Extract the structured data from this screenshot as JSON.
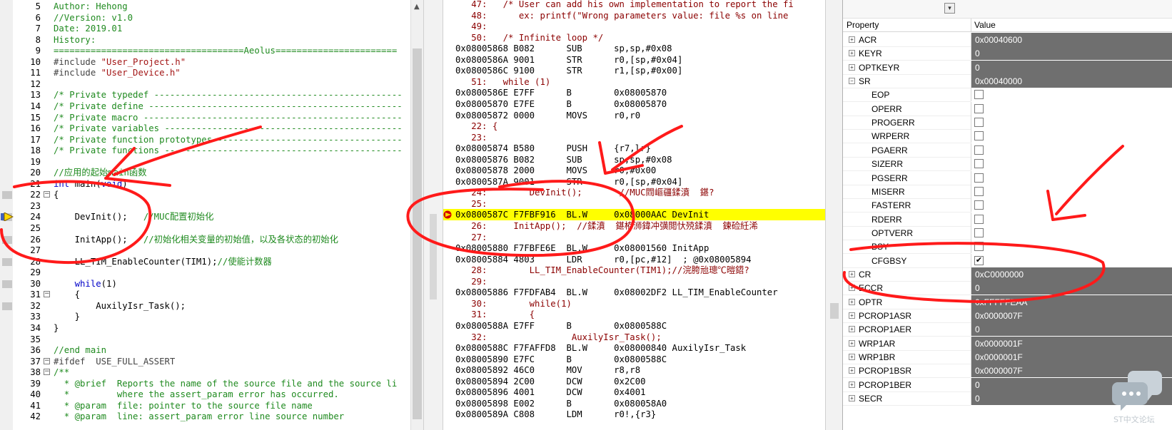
{
  "editor": {
    "lines": [
      {
        "n": "5",
        "text": "Author: Hehong",
        "cls": "c-comment",
        "fold": "",
        "mark": false
      },
      {
        "n": "6",
        "text": "//Version: v1.0",
        "cls": "c-comment",
        "fold": "",
        "mark": false
      },
      {
        "n": "7",
        "text": "Date: 2019.01",
        "cls": "c-comment",
        "fold": "",
        "mark": false
      },
      {
        "n": "8",
        "text": "History:",
        "cls": "c-comment",
        "fold": "",
        "mark": false
      },
      {
        "n": "9",
        "text": "====================================Aeolus=======================",
        "cls": "c-comment",
        "fold": "",
        "mark": false
      },
      {
        "n": "10",
        "text": "#include \"User_Project.h\"",
        "cls": "c-inc",
        "fold": "",
        "mark": false
      },
      {
        "n": "11",
        "text": "#include \"User_Device.h\"",
        "cls": "c-inc",
        "fold": "",
        "mark": false
      },
      {
        "n": "12",
        "text": "",
        "cls": "c-code",
        "fold": "",
        "mark": false
      },
      {
        "n": "13",
        "text": "/* Private typedef -----------------------------------------------",
        "cls": "c-comment",
        "fold": "",
        "mark": false
      },
      {
        "n": "14",
        "text": "/* Private define ------------------------------------------------",
        "cls": "c-comment",
        "fold": "",
        "mark": false
      },
      {
        "n": "15",
        "text": "/* Private macro -------------------------------------------------",
        "cls": "c-comment",
        "fold": "",
        "mark": false
      },
      {
        "n": "16",
        "text": "/* Private variables ---------------------------------------------",
        "cls": "c-comment",
        "fold": "",
        "mark": false
      },
      {
        "n": "17",
        "text": "/* Private function prototypes -----------------------------------",
        "cls": "c-comment",
        "fold": "",
        "mark": false
      },
      {
        "n": "18",
        "text": "/* Private functions ---------------------------------------------",
        "cls": "c-comment",
        "fold": "",
        "mark": false
      },
      {
        "n": "19",
        "text": "",
        "cls": "c-code",
        "fold": "",
        "mark": false
      },
      {
        "n": "20",
        "text": "//应用的起始main函数",
        "cls": "c-comment",
        "fold": "",
        "mark": false
      },
      {
        "n": "21",
        "text": "int main(void)",
        "cls": "c-main",
        "fold": "",
        "mark": false
      },
      {
        "n": "22",
        "text": "{",
        "cls": "c-code",
        "fold": "−",
        "mark": true
      },
      {
        "n": "23",
        "text": "",
        "cls": "c-code",
        "fold": "",
        "mark": false
      },
      {
        "n": "24",
        "text": "    DevInit();   //MUC配置初始化",
        "cls": "c-mixed",
        "fold": "",
        "mark": true,
        "arrow": true
      },
      {
        "n": "25",
        "text": "",
        "cls": "c-code",
        "fold": "",
        "mark": false
      },
      {
        "n": "26",
        "text": "    InitApp();   //初始化相关变量的初始值，以及各状态的初始化",
        "cls": "c-mixed",
        "fold": "",
        "mark": true
      },
      {
        "n": "27",
        "text": "",
        "cls": "c-code",
        "fold": "",
        "mark": false
      },
      {
        "n": "28",
        "text": "    LL_TIM_EnableCounter(TIM1);//使能计数器",
        "cls": "c-mixed",
        "fold": "",
        "mark": true
      },
      {
        "n": "29",
        "text": "",
        "cls": "c-code",
        "fold": "",
        "mark": false
      },
      {
        "n": "30",
        "text": "    while(1)",
        "cls": "c-while",
        "fold": "",
        "mark": true
      },
      {
        "n": "31",
        "text": "    {",
        "cls": "c-code",
        "fold": "−",
        "mark": false
      },
      {
        "n": "32",
        "text": "        AuxilyIsr_Task();",
        "cls": "c-code",
        "fold": "",
        "mark": true
      },
      {
        "n": "33",
        "text": "    }",
        "cls": "c-code",
        "fold": "",
        "mark": false
      },
      {
        "n": "34",
        "text": "}",
        "cls": "c-code",
        "fold": "",
        "mark": false
      },
      {
        "n": "35",
        "text": "",
        "cls": "c-code",
        "fold": "",
        "mark": false
      },
      {
        "n": "36",
        "text": "//end main",
        "cls": "c-comment",
        "fold": "",
        "mark": false
      },
      {
        "n": "37",
        "text": "#ifdef  USE_FULL_ASSERT",
        "cls": "c-pre",
        "fold": "−",
        "mark": false
      },
      {
        "n": "38",
        "text": "/**",
        "cls": "c-comment",
        "fold": "−",
        "mark": false
      },
      {
        "n": "39",
        "text": "  * @brief  Reports the name of the source file and the source li",
        "cls": "c-comment",
        "fold": "",
        "mark": false
      },
      {
        "n": "40",
        "text": "  *         where the assert_param error has occurred.",
        "cls": "c-comment",
        "fold": "",
        "mark": false
      },
      {
        "n": "41",
        "text": "  * @param  file: pointer to the source file name",
        "cls": "c-comment",
        "fold": "",
        "mark": false
      },
      {
        "n": "42",
        "text": "  * @param  line: assert_param error line source number",
        "cls": "c-comment",
        "fold": "",
        "mark": false
      }
    ]
  },
  "disasm": {
    "lines": [
      {
        "text": "   47:   /* User can add his own implementation to report the fi",
        "kind": "src"
      },
      {
        "text": "   48:      ex: printf(\"Wrong parameters value: file %s on line",
        "kind": "src"
      },
      {
        "text": "   49:",
        "kind": "src"
      },
      {
        "text": "   50:   /* Infinite loop */",
        "kind": "src"
      },
      {
        "text": "0x08005868 B082      SUB      sp,sp,#0x08",
        "kind": "asm"
      },
      {
        "text": "0x0800586A 9001      STR      r0,[sp,#0x04]",
        "kind": "asm"
      },
      {
        "text": "0x0800586C 9100      STR      r1,[sp,#0x00]",
        "kind": "asm"
      },
      {
        "text": "   51:   while (1)",
        "kind": "src"
      },
      {
        "text": "0x0800586E E7FF      B        0x08005870",
        "kind": "asm"
      },
      {
        "text": "0x08005870 E7FE      B        0x08005870",
        "kind": "asm"
      },
      {
        "text": "0x08005872 0000      MOVS     r0,r0",
        "kind": "asm"
      },
      {
        "text": "   22: {",
        "kind": "src"
      },
      {
        "text": "   23:",
        "kind": "src"
      },
      {
        "text": "0x08005874 B580      PUSH     {r7,lr}",
        "kind": "asm"
      },
      {
        "text": "0x08005876 B082      SUB      sp,sp,#0x08",
        "kind": "asm"
      },
      {
        "text": "0x08005878 2000      MOVS     r0,#0x00",
        "kind": "asm"
      },
      {
        "text": "0x0800587A 9001      STR      r0,[sp,#0x04]",
        "kind": "asm"
      },
      {
        "text": "   24:        DevInit();       //MUC閰嶇疆鍒濆  鍖?",
        "kind": "src"
      },
      {
        "text": "   25:",
        "kind": "src"
      },
      {
        "text": "0x0800587C F7FBF916  BL.W     0x08000AAC DevInit",
        "kind": "hl"
      },
      {
        "text": "   26:     InitApp();  //鍒濆  鍖栫浉鍏冲彉閲忕殑鍒濆  鍊硷紝浠",
        "kind": "src"
      },
      {
        "text": "   27:",
        "kind": "src"
      },
      {
        "text": "0x08005880 F7FBFE6E  BL.W     0x08001560 InitApp",
        "kind": "asm"
      },
      {
        "text": "0x08005884 4803      LDR      r0,[pc,#12]  ; @0x08005894",
        "kind": "asm"
      },
      {
        "text": "   28:        LL_TIM_EnableCounter(TIM1);//浣胯兘璁℃暟鍣?",
        "kind": "src"
      },
      {
        "text": "   29:",
        "kind": "src"
      },
      {
        "text": "0x08005886 F7FDFAB4  BL.W     0x08002DF2 LL_TIM_EnableCounter",
        "kind": "asm"
      },
      {
        "text": "   30:        while(1)",
        "kind": "src"
      },
      {
        "text": "   31:        {",
        "kind": "src"
      },
      {
        "text": "0x0800588A E7FF      B        0x0800588C",
        "kind": "asm"
      },
      {
        "text": "   32:                AuxilyIsr_Task();",
        "kind": "src"
      },
      {
        "text": "0x0800588C F7FAFFD8  BL.W     0x08000840 AuxilyIsr_Task",
        "kind": "asm"
      },
      {
        "text": "0x08005890 E7FC      B        0x0800588C",
        "kind": "asm"
      },
      {
        "text": "0x08005892 46C0      MOV      r8,r8",
        "kind": "asm"
      },
      {
        "text": "0x08005894 2C00      DCW      0x2C00",
        "kind": "asm"
      },
      {
        "text": "0x08005896 4001      DCW      0x4001",
        "kind": "asm"
      },
      {
        "text": "0x08005898 E002      B        0x080058A0",
        "kind": "asm"
      },
      {
        "text": "0x0800589A C808      LDM      r0!,{r3}",
        "kind": "asm"
      }
    ]
  },
  "props": {
    "header_property": "Property",
    "header_value": "Value",
    "dropdown_glyph": "▾",
    "rows": [
      {
        "name": "ACR",
        "value": "0x00040600",
        "type": "reg",
        "expander": "+"
      },
      {
        "name": "KEYR",
        "value": "0",
        "type": "reg",
        "expander": "+"
      },
      {
        "name": "OPTKEYR",
        "value": "0",
        "type": "reg",
        "expander": "+"
      },
      {
        "name": "SR",
        "value": "0x00040000",
        "type": "reg",
        "expander": "−"
      },
      {
        "name": "EOP",
        "checked": false,
        "type": "bit"
      },
      {
        "name": "OPERR",
        "checked": false,
        "type": "bit"
      },
      {
        "name": "PROGERR",
        "checked": false,
        "type": "bit"
      },
      {
        "name": "WRPERR",
        "checked": false,
        "type": "bit"
      },
      {
        "name": "PGAERR",
        "checked": false,
        "type": "bit"
      },
      {
        "name": "SIZERR",
        "checked": false,
        "type": "bit"
      },
      {
        "name": "PGSERR",
        "checked": false,
        "type": "bit"
      },
      {
        "name": "MISERR",
        "checked": false,
        "type": "bit"
      },
      {
        "name": "FASTERR",
        "checked": false,
        "type": "bit"
      },
      {
        "name": "RDERR",
        "checked": false,
        "type": "bit"
      },
      {
        "name": "OPTVERR",
        "checked": false,
        "type": "bit"
      },
      {
        "name": "BSY",
        "checked": false,
        "type": "bit"
      },
      {
        "name": "CFGBSY",
        "checked": true,
        "type": "bit"
      },
      {
        "name": "CR",
        "value": "0xC0000000",
        "type": "reg",
        "expander": "+"
      },
      {
        "name": "ECCR",
        "value": "0",
        "type": "reg",
        "expander": "+"
      },
      {
        "name": "OPTR",
        "value": "0xFFFFFEAA",
        "type": "reg",
        "expander": "+"
      },
      {
        "name": "PCROP1ASR",
        "value": "0x0000007F",
        "type": "reg",
        "expander": "+"
      },
      {
        "name": "PCROP1AER",
        "value": "0",
        "type": "reg",
        "expander": "+"
      },
      {
        "name": "WRP1AR",
        "value": "0x0000001F",
        "type": "reg",
        "expander": "+"
      },
      {
        "name": "WRP1BR",
        "value": "0x0000001F",
        "type": "reg",
        "expander": "+"
      },
      {
        "name": "PCROP1BSR",
        "value": "0x0000007F",
        "type": "reg",
        "expander": "+"
      },
      {
        "name": "PCROP1BER",
        "value": "0",
        "type": "reg",
        "expander": "+"
      },
      {
        "name": "SECR",
        "value": "0",
        "type": "reg",
        "expander": "+"
      }
    ]
  },
  "watermark": {
    "text": "ST中文论坛",
    "icon": "chat-bubble-icon"
  },
  "colors": {
    "annotation_red": "#ff1a1a",
    "highlight": "#ffff00",
    "value_cell": "#6f6f6f",
    "comment": "#1f8a1f",
    "keyword": "#0000c8"
  }
}
